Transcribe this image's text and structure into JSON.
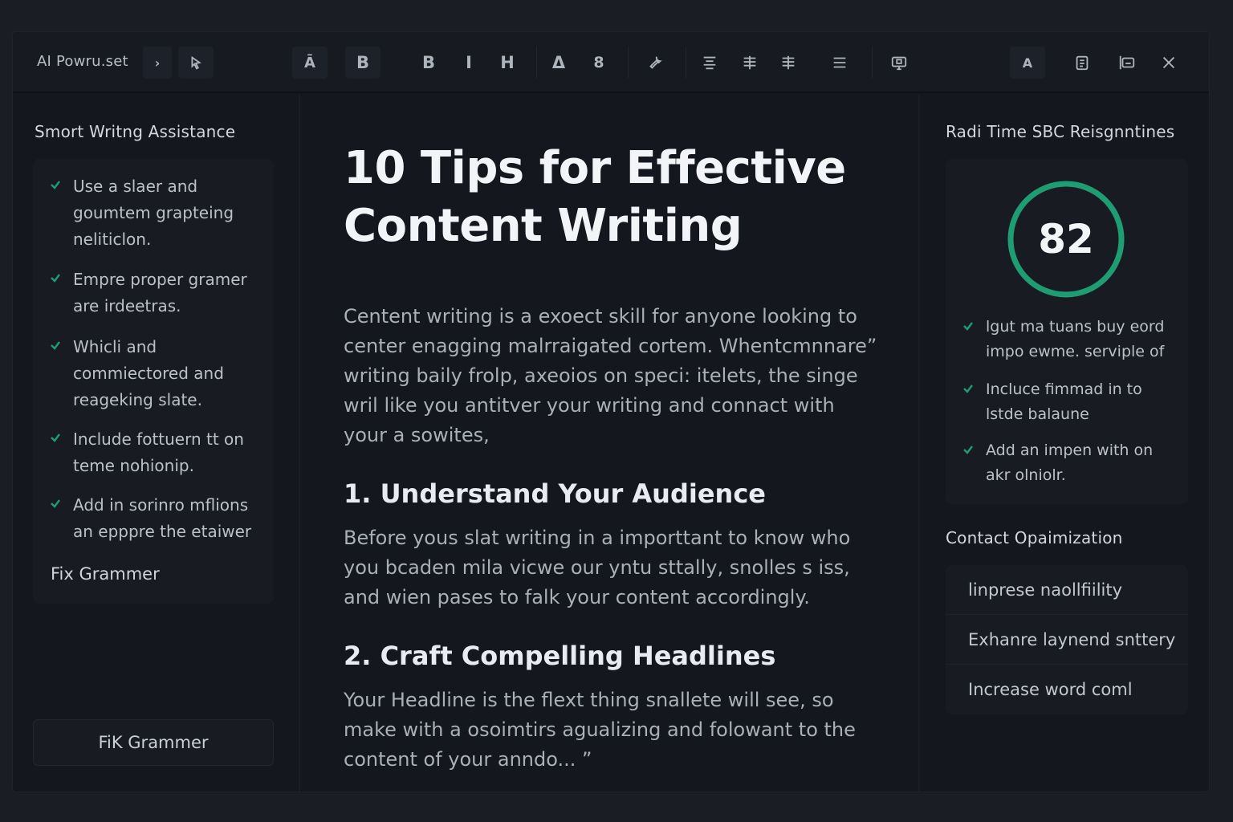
{
  "toolbar": {
    "title": "AI Powru.set",
    "arrow": "›",
    "btn_font_a": "Ā",
    "btn_bold_boxed": "B",
    "btn_bold": "B",
    "btn_italic": "I",
    "btn_heading": "H",
    "btn_delta": "Δ",
    "btn_eight": "8",
    "btn_right_a": "A"
  },
  "left": {
    "title": "Smort Writng Assistance",
    "suggestions": [
      {
        "text": "Use a slaer and goumtem grapteing neliticlon."
      },
      {
        "text": "Empre proper gramer are irdeetras."
      },
      {
        "text": "Whicli and commiectored and reageking slate."
      },
      {
        "text": "Include fottuern tt on teme nohionip."
      },
      {
        "text": "Add in sorinro mflions an epppre the etaiwer"
      }
    ],
    "fix_link": "Fix Grammer",
    "fix_button": "FiK Grammer"
  },
  "doc": {
    "title": "10 Tips for Effective Content Writing",
    "intro": "Centent writing is a exoect skill for anyone looking to center enagging malrraigated cortem. Whentcmnnare” writing baily frolp, axeoios on speci: itelets, the singe wril like you antitver your writing and connact with your a sowites,",
    "h1": "1. Understand Your Audience",
    "p1": "Before yous slat writing in a importtant to know who you bcaden mila vicwe our yntu sttally, snolles s iss, and wien pases to falk your content accordingly.",
    "h2": "2. Craft Compelling Headlines",
    "p2": "Your Headline is the flext thing snallete will see, so make with a osoimtirs agualizing and folowant to the content of your anndo... ”"
  },
  "right": {
    "title": "Radi Time SBC Reisgnntines",
    "score": "82",
    "score_fraction": 1.0,
    "suggestions": [
      {
        "text": "lgut ma tuans buy eord impo ewme. serviple of"
      },
      {
        "text": "Incluce fimmad in to lstde balaune"
      },
      {
        "text": "Add an impen with on akr olniolr."
      }
    ],
    "opt_title": "Contact Opaimization",
    "opt_items": [
      {
        "label": "linprese naollfiility"
      },
      {
        "label": "Exhanre laynend snttery"
      },
      {
        "label": "Increase word coml"
      }
    ]
  },
  "colors": {
    "accent_green": "#1f9d72",
    "background": "#14171d",
    "panel": "#181b22"
  },
  "icons": [
    "chevron-right-icon",
    "cursor-icon",
    "wrench-icon",
    "align-center-icon",
    "align-justify-icon",
    "list-icon",
    "monitor-icon",
    "clipboard-icon",
    "layout-icon",
    "close-icon",
    "check-icon"
  ]
}
